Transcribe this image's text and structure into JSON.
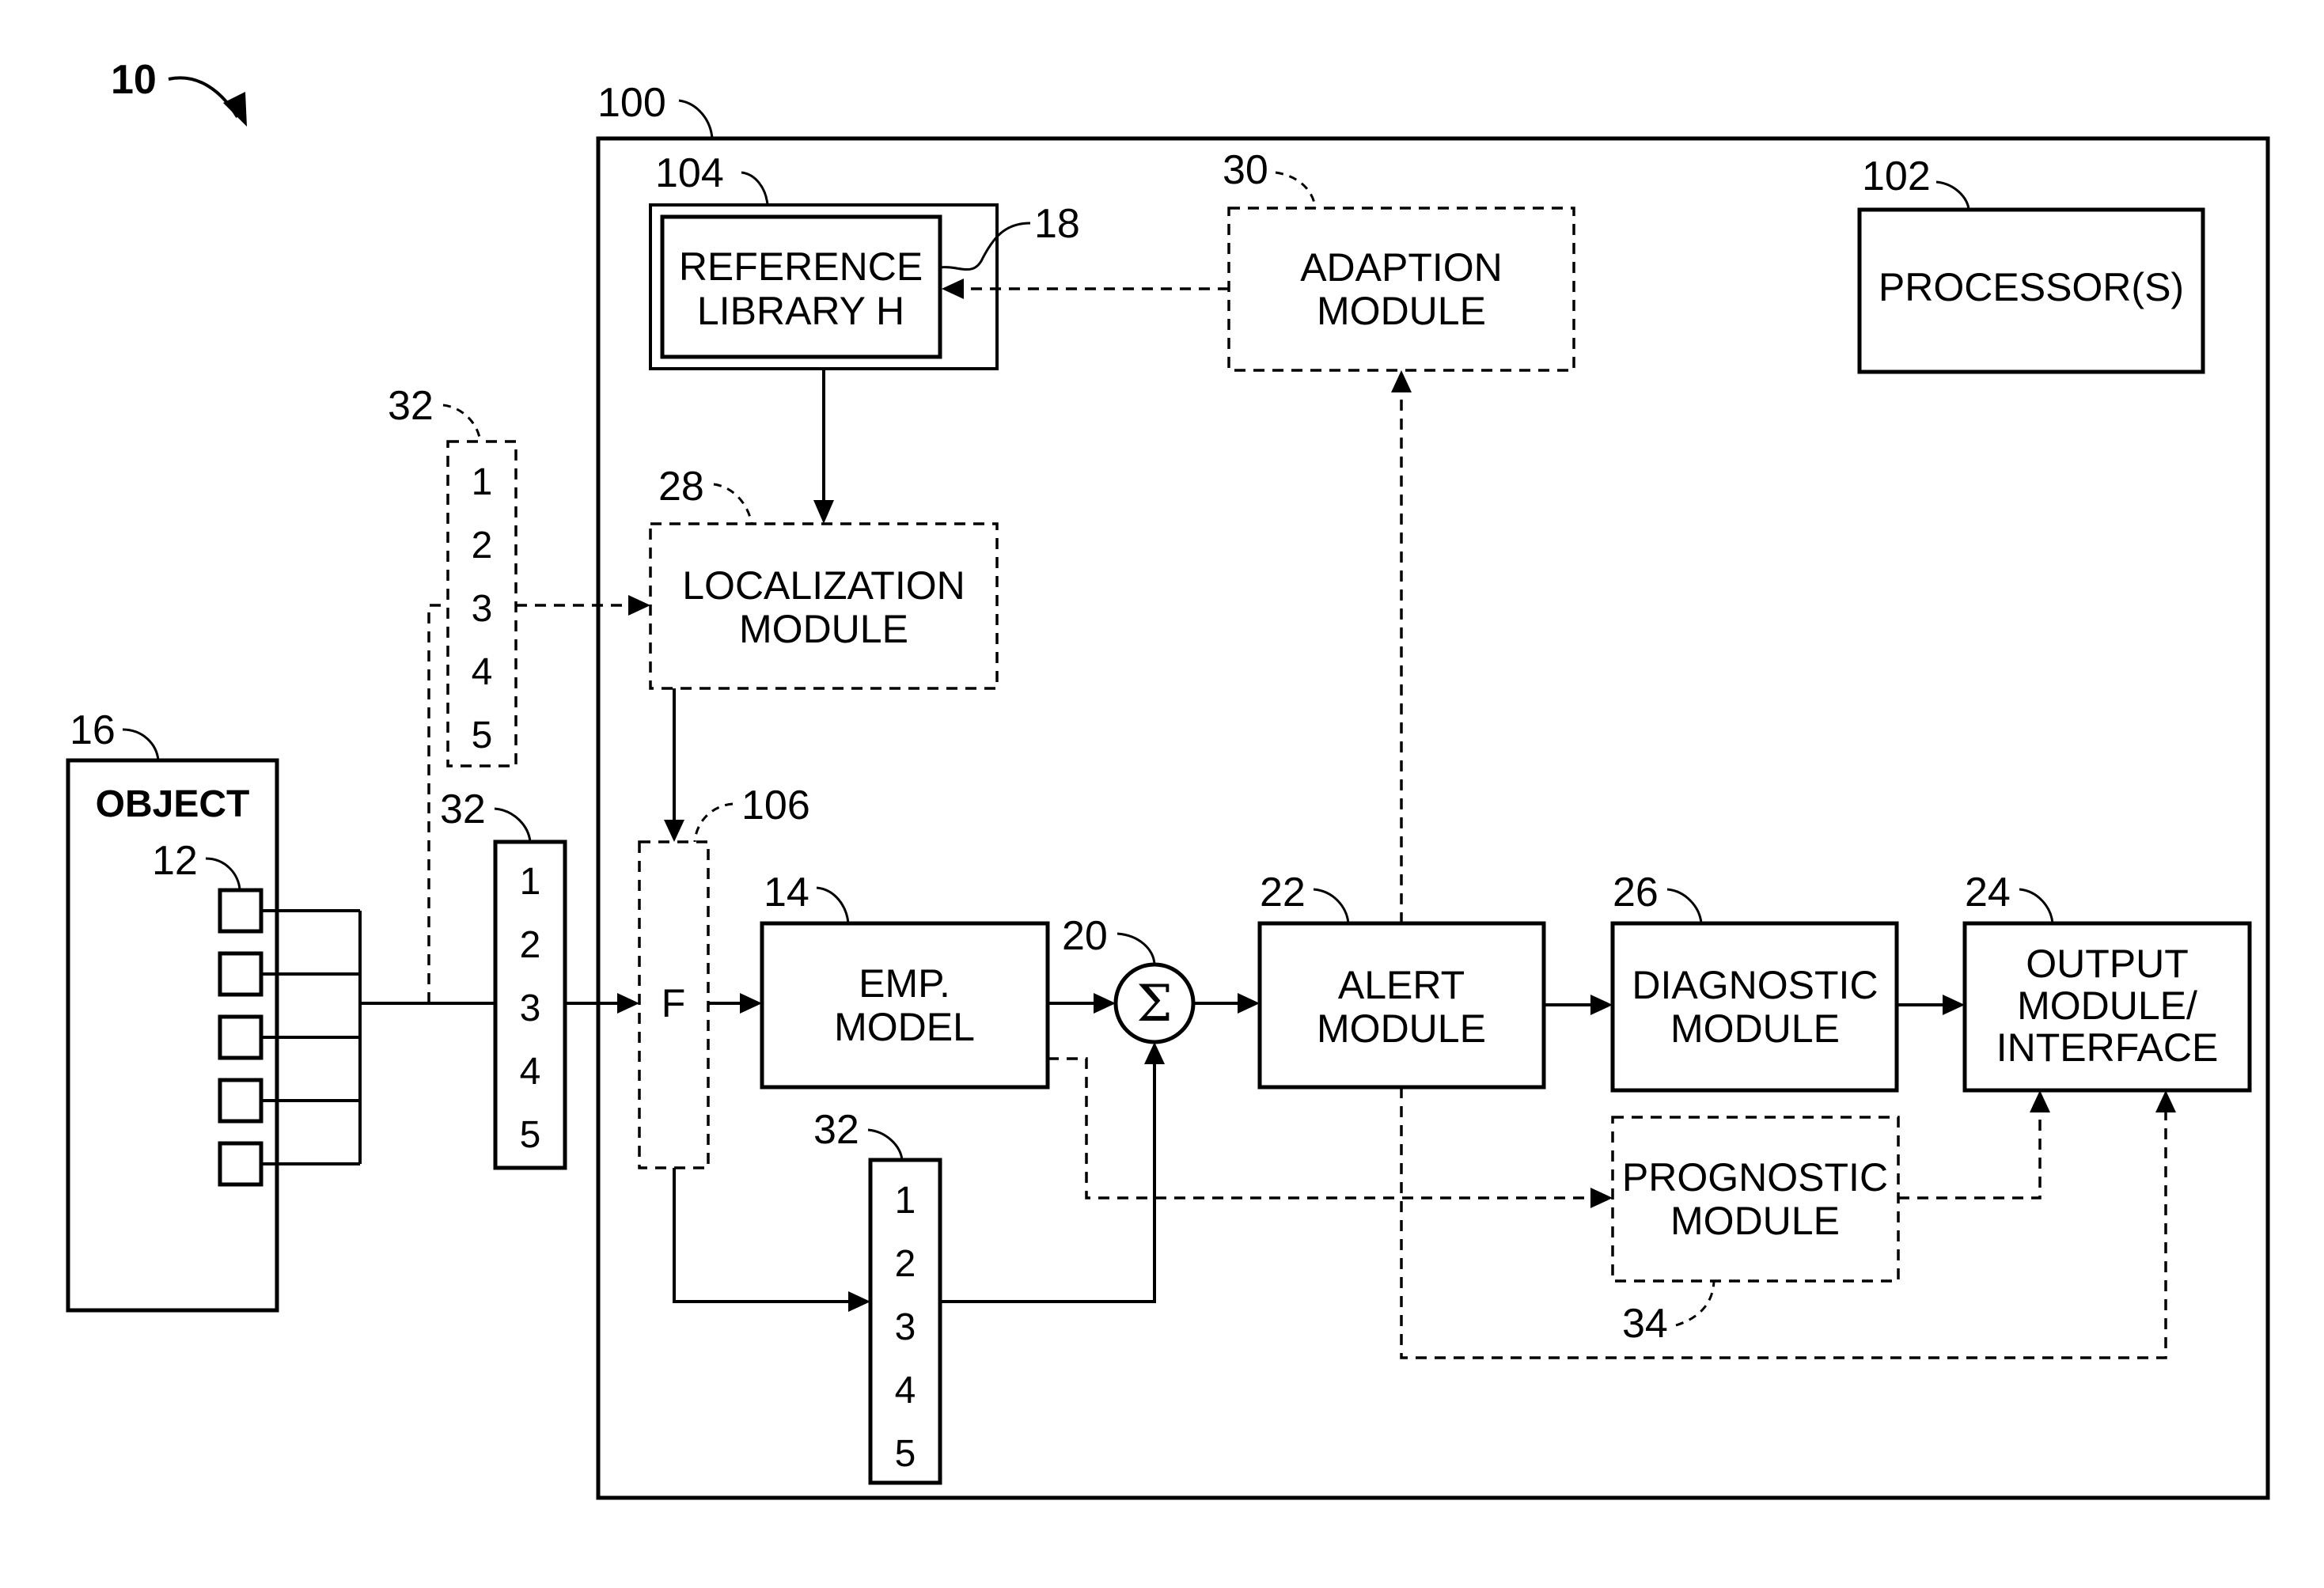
{
  "figure": {
    "system_ref": "10",
    "computer_ref": "100"
  },
  "blocks": {
    "reference_library": {
      "ref": "104",
      "inner_ref": "18",
      "lines": [
        "REFERENCE",
        "LIBRARY H"
      ]
    },
    "adaption_module": {
      "ref": "30",
      "lines": [
        "ADAPTION",
        "MODULE"
      ]
    },
    "processor": {
      "ref": "102",
      "lines": [
        "PROCESSOR(S)"
      ]
    },
    "localization_module": {
      "ref": "28",
      "lines": [
        "LOCALIZATION",
        "MODULE"
      ]
    },
    "object": {
      "ref": "16",
      "label": "OBJECT",
      "sensor_ref": "12"
    },
    "filter": {
      "ref": "106",
      "label": "F"
    },
    "emp_model": {
      "ref": "14",
      "lines": [
        "EMP.",
        "MODEL"
      ]
    },
    "summer": {
      "ref": "20",
      "symbol": "Σ"
    },
    "alert_module": {
      "ref": "22",
      "lines": [
        "ALERT",
        "MODULE"
      ]
    },
    "diagnostic_module": {
      "ref": "26",
      "lines": [
        "DIAGNOSTIC",
        "MODULE"
      ]
    },
    "output_module": {
      "ref": "24",
      "lines": [
        "OUTPUT",
        "MODULE/",
        "INTERFACE"
      ]
    },
    "prognostic_module": {
      "ref": "34",
      "lines": [
        "PROGNOSTIC",
        "MODULE"
      ]
    }
  },
  "vectors": {
    "ref": "32",
    "entries": [
      "1",
      "2",
      "3",
      "4",
      "5"
    ]
  }
}
